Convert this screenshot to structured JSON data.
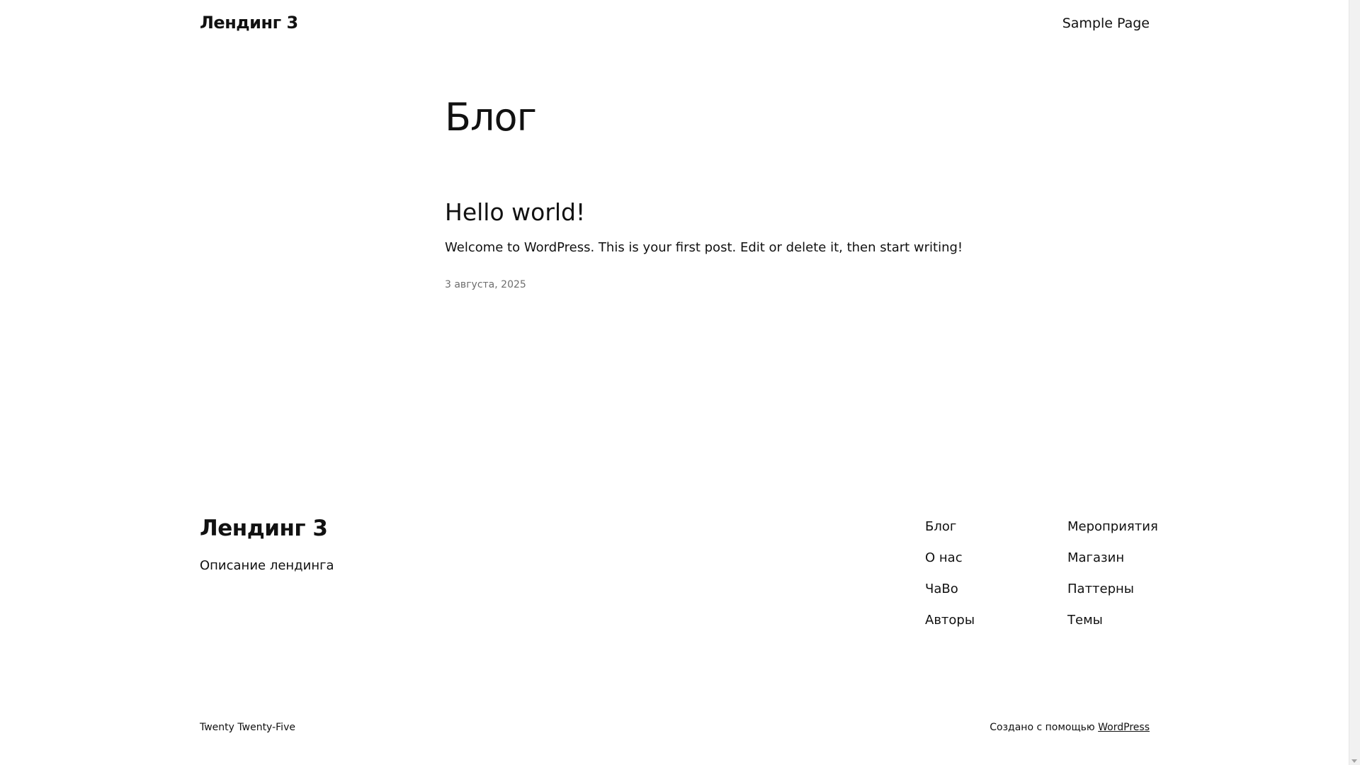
{
  "header": {
    "site_title": "Лендинг 3",
    "nav_link": "Sample Page"
  },
  "main": {
    "page_heading": "Блог",
    "post": {
      "title": "Hello world!",
      "excerpt": "Welcome to WordPress. This is your first post. Edit or delete it, then start writing!",
      "date": "3 августа, 2025"
    }
  },
  "footer": {
    "site_title": "Лендинг 3",
    "tagline": "Описание лендинга",
    "nav_col_1": [
      "Блог",
      "О нас",
      "ЧаВо",
      "Авторы"
    ],
    "nav_col_2": [
      "Мероприятия",
      "Магазин",
      "Паттерны",
      "Темы"
    ],
    "credit_theme": "Twenty Twenty-Five",
    "credit_prefix": "Создано с помощью ",
    "credit_link": "WordPress"
  },
  "colors": {
    "text": "#111111",
    "muted": "#6e6e6e",
    "background": "#ffffff"
  }
}
